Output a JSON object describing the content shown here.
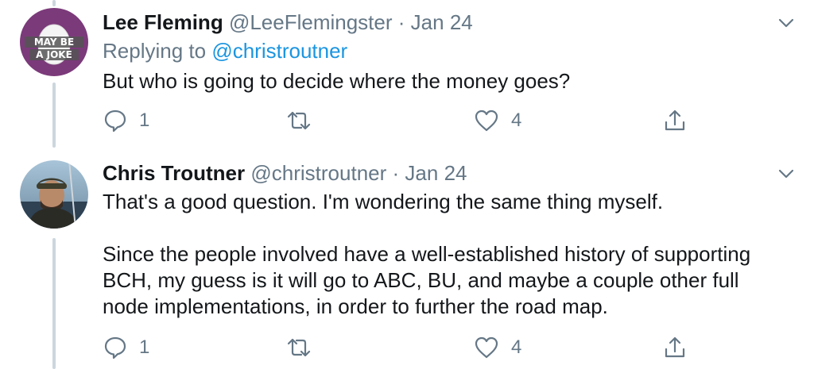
{
  "tweets": [
    {
      "name": "Lee Fleming",
      "handle": "@LeeFlemingster",
      "separator": "·",
      "date": "Jan 24",
      "replying_prefix": "Replying to ",
      "replying_to": "@christroutner",
      "text": "But who is going to decide where the money goes?",
      "avatar": {
        "type": "egg-logo",
        "line1": "MAY BE",
        "line2": "A JOKE",
        "bg_color": "#7b3a7a"
      },
      "reply_count": "1",
      "retweet_count": "",
      "like_count": "4"
    },
    {
      "name": "Chris Troutner",
      "handle": "@christroutner",
      "separator": "·",
      "date": "Jan 24",
      "text": "That's a good question. I'm wondering the same thing myself.\n\nSince the people involved have a well-established history of supporting BCH, my guess is it will go to ABC, BU, and maybe a couple other full node implementations, in order to further the road map.",
      "avatar": {
        "type": "photo"
      },
      "reply_count": "1",
      "retweet_count": "",
      "like_count": "4"
    }
  ],
  "icons": {
    "reply": "reply-icon",
    "retweet": "retweet-icon",
    "like": "like-icon",
    "share": "share-icon",
    "more": "chevron-down-icon"
  },
  "colors": {
    "text": "#14171a",
    "secondary": "#657786",
    "link": "#1b95e0",
    "thread_line": "#ccd6dd"
  }
}
